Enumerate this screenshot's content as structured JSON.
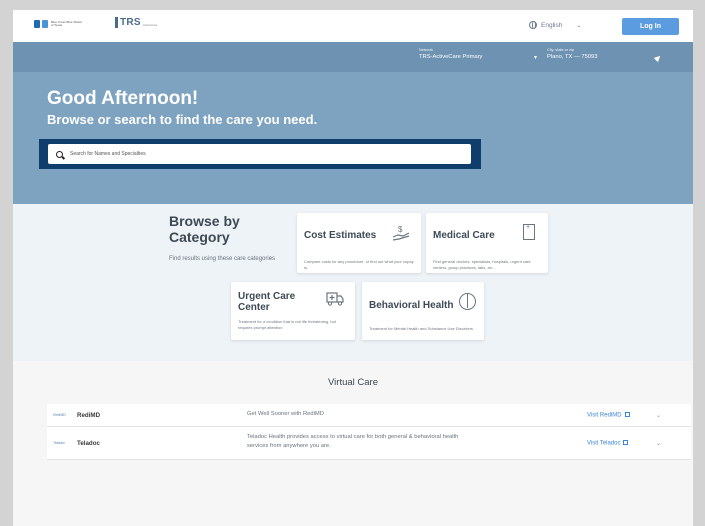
{
  "header": {
    "brand_logo_text": "Blue Cross Blue Shield of Texas",
    "partner_logo_text": "TRS",
    "partner_logo_subtext": "ActiveCare",
    "language_label": "English",
    "login_label": "Log In"
  },
  "hero": {
    "network_label": "Network",
    "network_value": "TRS-ActiveCare Primary",
    "location_label": "City, state or zip",
    "location_value": "Plano, TX — 75093",
    "greeting": "Good Afternoon!",
    "subheading": "Browse or search to find the care you need.",
    "search_placeholder": "Search for Names and Specialties"
  },
  "categories": {
    "heading": "Browse by Category",
    "subheading": "Find results using these care categories",
    "cards": [
      {
        "title": "Cost Estimates",
        "description": "Compare costs for any procedure, or find out what your copay is.",
        "icon": "hand-dollar-icon"
      },
      {
        "title": "Medical Care",
        "description": "Find general doctors, specialists, hospitals, urgent care centers, group practices, labs, an...",
        "icon": "hospital-building-icon"
      },
      {
        "title": "Urgent Care Center",
        "description": "Treatment for a condition that is not life threatening, but requires prompt attention",
        "icon": "ambulance-icon"
      },
      {
        "title": "Behavioral Health",
        "description": "Treatment for Mental Health and Substance Use Disorders",
        "icon": "brain-icon"
      }
    ]
  },
  "virtual_care": {
    "heading": "Virtual Care",
    "providers": [
      {
        "logo": "RediMD",
        "name": "RediMD",
        "description": "Get Well Sooner with RediMD",
        "link": "Visit RediMD"
      },
      {
        "logo": "Teladoc",
        "name": "Teladoc",
        "description": "Teladoc Health provides access to virtual care for both general & behavioral health services from anywhere you are.",
        "link": "Visit Teladoc"
      }
    ]
  },
  "colors": {
    "hero_bg": "#7ea3c0",
    "network_bar": "#6e93b2",
    "search_frame": "#0f3e6c",
    "login_button": "#5b9be0",
    "link": "#3d86d6"
  }
}
